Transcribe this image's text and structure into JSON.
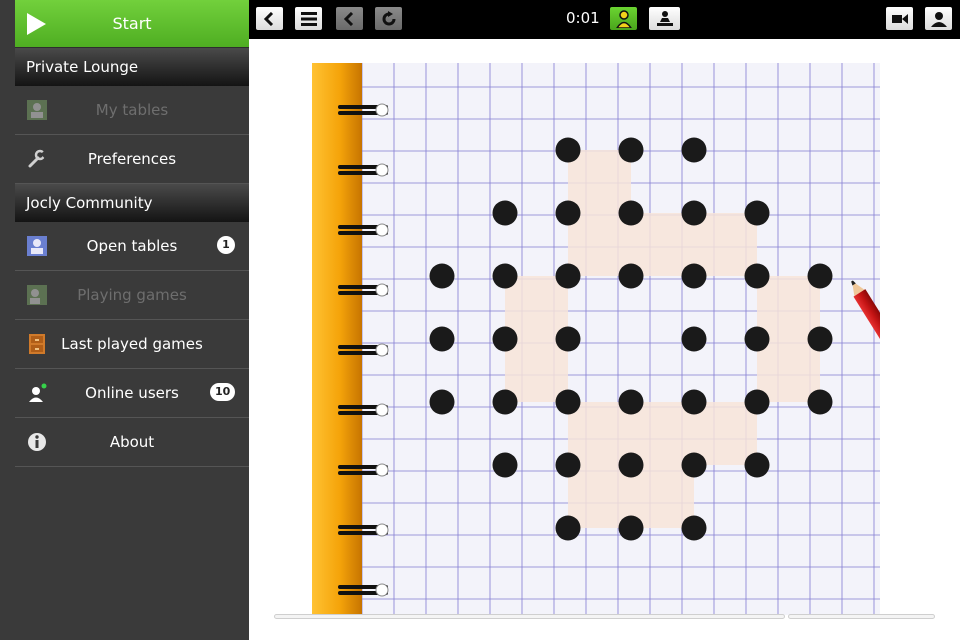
{
  "sidebar": {
    "start": {
      "label": "Start",
      "icon": "play-icon"
    },
    "sections": [
      {
        "title": "Private Lounge",
        "items": [
          {
            "label": "My tables",
            "icon": "my-tables-icon",
            "disabled": true,
            "badge": ""
          },
          {
            "label": "Preferences",
            "icon": "wrench-icon",
            "disabled": false,
            "badge": ""
          }
        ]
      },
      {
        "title": "Jocly Community",
        "items": [
          {
            "label": "Open tables",
            "icon": "open-tables-icon",
            "disabled": false,
            "badge": "1"
          },
          {
            "label": "Playing games",
            "icon": "playing-games-icon",
            "disabled": true,
            "badge": ""
          },
          {
            "label": "Last played games",
            "icon": "cabinet-icon",
            "disabled": false,
            "badge": ""
          },
          {
            "label": "Online users",
            "icon": "online-users-icon",
            "disabled": false,
            "badge": "10"
          },
          {
            "label": "About",
            "icon": "info-icon",
            "disabled": false,
            "badge": ""
          }
        ]
      }
    ]
  },
  "topbar": {
    "timer": "0:01",
    "buttons_left": [
      "back-icon",
      "menu-icon",
      "undo-icon",
      "restart-icon"
    ],
    "buttons_center": [
      "player-turn-icon",
      "switch-sides-icon"
    ],
    "buttons_right": [
      "video-camera-icon",
      "user-icon"
    ]
  },
  "board": {
    "spiral_rings": 9,
    "grid": {
      "dot_positions_note": ""
    },
    "rows": [
      [
        0,
        0,
        1,
        1,
        1,
        0,
        0
      ],
      [
        0,
        1,
        1,
        1,
        1,
        1,
        0
      ],
      [
        1,
        1,
        1,
        1,
        1,
        1,
        1
      ],
      [
        1,
        1,
        1,
        0,
        1,
        1,
        1
      ],
      [
        1,
        1,
        1,
        1,
        1,
        1,
        1
      ],
      [
        0,
        1,
        1,
        1,
        1,
        1,
        0
      ],
      [
        0,
        0,
        1,
        1,
        1,
        0,
        0
      ]
    ],
    "shaded_cells": [
      [
        1,
        0
      ],
      [
        1,
        1
      ],
      [
        2,
        1
      ],
      [
        3,
        1
      ],
      [
        0,
        2
      ],
      [
        4,
        2
      ],
      [
        0,
        3
      ],
      [
        4,
        3
      ],
      [
        1,
        4
      ],
      [
        2,
        4
      ],
      [
        3,
        4
      ],
      [
        1,
        5
      ],
      [
        2,
        5
      ]
    ],
    "colors": {
      "dot": "#1a1a1a",
      "shade": "#f7e4d8",
      "grid": "#8b85d6",
      "spine": "#f5a40a"
    }
  }
}
